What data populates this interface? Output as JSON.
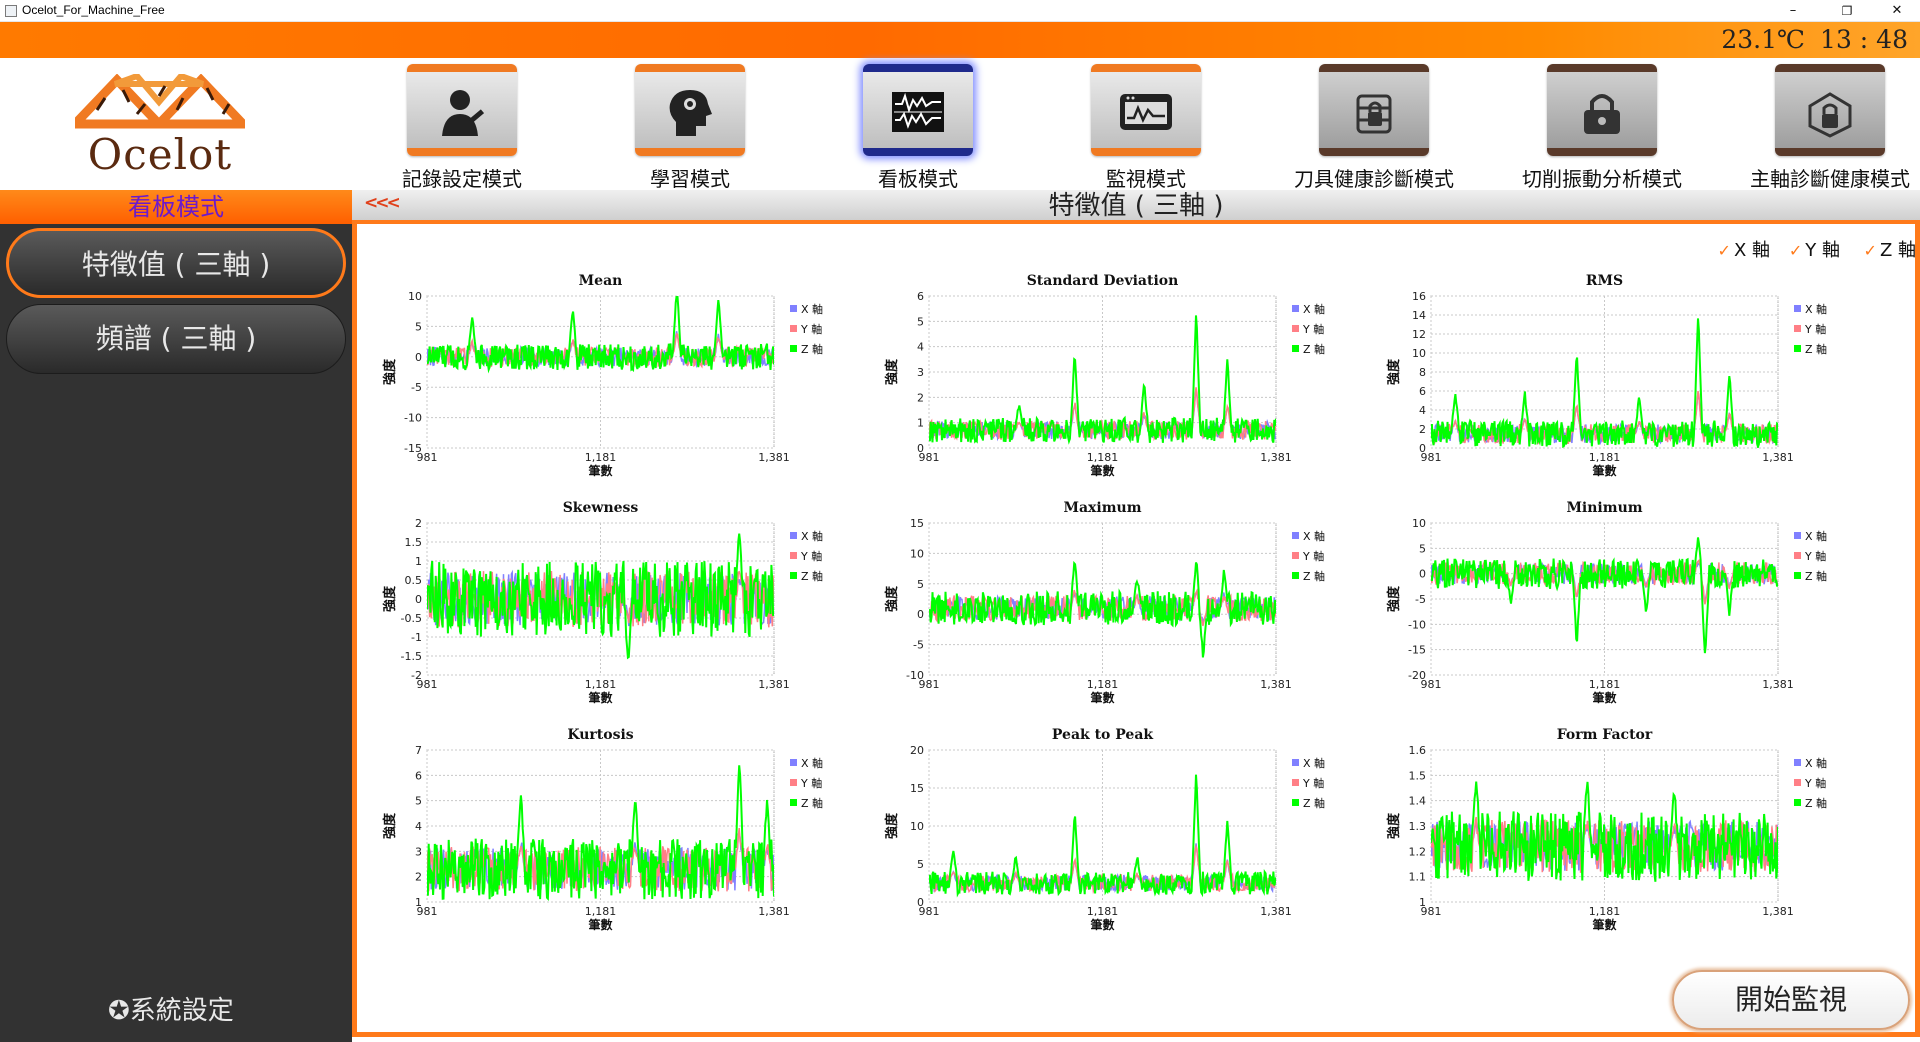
{
  "window": {
    "title": "Ocelot_For_Machine_Free",
    "minimize": "–",
    "restore": "❐",
    "close": "✕"
  },
  "header": {
    "temperature": "23.1℃",
    "clock": "13 : 48"
  },
  "logo": {
    "brand": "Ocelot"
  },
  "modes": [
    {
      "label": "記錄設定模式",
      "icon": "user-wrench-icon",
      "state": "normal"
    },
    {
      "label": "學習模式",
      "icon": "brain-gear-icon",
      "state": "normal"
    },
    {
      "label": "看板模式",
      "icon": "waveform-board-icon",
      "state": "active"
    },
    {
      "label": "監視模式",
      "icon": "monitor-screen-icon",
      "state": "normal"
    },
    {
      "label": "刀具健康診斷模式",
      "icon": "tool-lock-icon",
      "state": "disabled"
    },
    {
      "label": "切削振動分析模式",
      "icon": "padlock-icon",
      "state": "disabled"
    },
    {
      "label": "主軸診斷健康模式",
      "icon": "spindle-lock-icon",
      "state": "disabled"
    }
  ],
  "sidebar": {
    "title": "看板模式",
    "items": [
      {
        "label": "特徵值 ( 三軸 )",
        "active": true
      },
      {
        "label": "頻譜 ( 三軸 )",
        "active": false
      }
    ],
    "settings": "系統設定"
  },
  "content": {
    "back": "<<<",
    "title": "特徵值 ( 三軸 )",
    "axis_toggles": [
      {
        "label": "X 軸",
        "checked": true
      },
      {
        "label": "Y 軸",
        "checked": true
      },
      {
        "label": "Z 軸",
        "checked": true
      }
    ],
    "start_button": "開始監視"
  },
  "colors": {
    "x_axis": "#8080ff",
    "y_axis": "#ff7f86",
    "z_axis": "#00ff00",
    "accent": "#ff7a1a",
    "active_mode": "#1f2a8c"
  },
  "chart_data": [
    {
      "type": "line",
      "title": "Mean",
      "xlabel": "筆數",
      "ylabel": "強度",
      "xlim": [
        981,
        1381
      ],
      "xticks": [
        "981",
        "1,181",
        "1,381"
      ],
      "ylim": [
        -15,
        10
      ],
      "yticks": [
        "-15",
        "-10",
        "-5",
        "0",
        "5",
        "10"
      ],
      "base": 0,
      "amp": 2.2,
      "spikes": [
        [
          0.13,
          7
        ],
        [
          0.42,
          8
        ],
        [
          0.72,
          12
        ],
        [
          0.84,
          10
        ]
      ],
      "series": [
        {
          "name": "X 軸"
        },
        {
          "name": "Y 軸"
        },
        {
          "name": "Z 軸"
        }
      ],
      "legend": "right"
    },
    {
      "type": "line",
      "title": "Standard Deviation",
      "xlabel": "筆數",
      "ylabel": "強度",
      "xlim": [
        981,
        1381
      ],
      "xticks": [
        "981",
        "1,181",
        "1,381"
      ],
      "ylim": [
        0,
        6
      ],
      "yticks": [
        "0",
        "1",
        "2",
        "3",
        "4",
        "5",
        "6"
      ],
      "base": 0.7,
      "amp": 0.5,
      "spikes": [
        [
          0.26,
          1.8
        ],
        [
          0.42,
          3.8
        ],
        [
          0.62,
          2.6
        ],
        [
          0.77,
          5.5
        ],
        [
          0.86,
          3.5
        ]
      ],
      "series": [
        {
          "name": "X 軸"
        },
        {
          "name": "Y 軸"
        },
        {
          "name": "Z 軸"
        }
      ],
      "legend": "right"
    },
    {
      "type": "line",
      "title": "RMS",
      "xlabel": "筆數",
      "ylabel": "強度",
      "xlim": [
        981,
        1381
      ],
      "xticks": [
        "981",
        "1,181",
        "1,381"
      ],
      "ylim": [
        0,
        16
      ],
      "yticks": [
        "0",
        "2",
        "4",
        "6",
        "8",
        "10",
        "12",
        "14",
        "16"
      ],
      "base": 1.5,
      "amp": 1.4,
      "spikes": [
        [
          0.07,
          6
        ],
        [
          0.27,
          6
        ],
        [
          0.42,
          10
        ],
        [
          0.6,
          5.5
        ],
        [
          0.77,
          14.5
        ],
        [
          0.86,
          8
        ]
      ],
      "series": [
        {
          "name": "X 軸"
        },
        {
          "name": "Y 軸"
        },
        {
          "name": "Z 軸"
        }
      ],
      "legend": "right"
    },
    {
      "type": "line",
      "title": "Skewness",
      "xlabel": "筆數",
      "ylabel": "強度",
      "xlim": [
        981,
        1381
      ],
      "xticks": [
        "981",
        "1,181",
        "1,381"
      ],
      "ylim": [
        -2,
        2
      ],
      "yticks": [
        "-2",
        "-1.5",
        "-1",
        "-0.5",
        "0",
        "0.5",
        "1",
        "1.5",
        "2"
      ],
      "base": 0,
      "amp": 1.0,
      "spikes": [
        [
          0.58,
          -1.7
        ],
        [
          0.9,
          1.9
        ]
      ],
      "series": [
        {
          "name": "X 軸"
        },
        {
          "name": "Y 軸"
        },
        {
          "name": "Z 軸"
        }
      ],
      "legend": "right"
    },
    {
      "type": "line",
      "title": "Maximum",
      "xlabel": "筆數",
      "ylabel": "強度",
      "xlim": [
        981,
        1381
      ],
      "xticks": [
        "981",
        "1,181",
        "1,381"
      ],
      "ylim": [
        -10,
        15
      ],
      "yticks": [
        "-10",
        "-5",
        "0",
        "5",
        "10",
        "15"
      ],
      "base": 1,
      "amp": 2.8,
      "spikes": [
        [
          0.42,
          9
        ],
        [
          0.6,
          6
        ],
        [
          0.77,
          9
        ],
        [
          0.79,
          -7
        ],
        [
          0.85,
          7
        ]
      ],
      "series": [
        {
          "name": "X 軸"
        },
        {
          "name": "Y 軸"
        },
        {
          "name": "Z 軸"
        }
      ],
      "legend": "right"
    },
    {
      "type": "line",
      "title": "Minimum",
      "xlabel": "筆數",
      "ylabel": "強度",
      "xlim": [
        981,
        1381
      ],
      "xticks": [
        "981",
        "1,181",
        "1,381"
      ],
      "ylim": [
        -20,
        10
      ],
      "yticks": [
        "-20",
        "-15",
        "-10",
        "-5",
        "0",
        "5",
        "10"
      ],
      "base": 0,
      "amp": 3.0,
      "spikes": [
        [
          0.23,
          -6
        ],
        [
          0.42,
          -14
        ],
        [
          0.62,
          -8
        ],
        [
          0.77,
          7
        ],
        [
          0.79,
          -17
        ],
        [
          0.86,
          -8
        ]
      ],
      "series": [
        {
          "name": "X 軸"
        },
        {
          "name": "Y 軸"
        },
        {
          "name": "Z 軸"
        }
      ],
      "legend": "right"
    },
    {
      "type": "line",
      "title": "Kurtosis",
      "xlabel": "筆數",
      "ylabel": "強度",
      "xlim": [
        981,
        1381
      ],
      "xticks": [
        "981",
        "1,181",
        "1,381"
      ],
      "ylim": [
        1,
        7
      ],
      "yticks": [
        "1",
        "2",
        "3",
        "4",
        "5",
        "6",
        "7"
      ],
      "base": 2.3,
      "amp": 1.2,
      "spikes": [
        [
          0.27,
          5.5
        ],
        [
          0.6,
          5.2
        ],
        [
          0.9,
          6.7
        ],
        [
          0.98,
          5
        ]
      ],
      "series": [
        {
          "name": "X 軸"
        },
        {
          "name": "Y 軸"
        },
        {
          "name": "Z 軸"
        }
      ],
      "legend": "right"
    },
    {
      "type": "line",
      "title": "Peak to Peak",
      "xlabel": "筆數",
      "ylabel": "強度",
      "xlim": [
        981,
        1381
      ],
      "xticks": [
        "981",
        "1,181",
        "1,381"
      ],
      "ylim": [
        0,
        20
      ],
      "yticks": [
        "0",
        "5",
        "10",
        "15",
        "20"
      ],
      "base": 2.5,
      "amp": 1.5,
      "spikes": [
        [
          0.07,
          7
        ],
        [
          0.25,
          6
        ],
        [
          0.42,
          12
        ],
        [
          0.6,
          6
        ],
        [
          0.77,
          17.5
        ],
        [
          0.86,
          11
        ]
      ],
      "series": [
        {
          "name": "X 軸"
        },
        {
          "name": "Y 軸"
        },
        {
          "name": "Z 軸"
        }
      ],
      "legend": "right"
    },
    {
      "type": "line",
      "title": "Form Factor",
      "xlabel": "筆數",
      "ylabel": "強度",
      "xlim": [
        981,
        1381
      ],
      "xticks": [
        "981",
        "1,181",
        "1,381"
      ],
      "ylim": [
        1,
        1.6
      ],
      "yticks": [
        "1",
        "1.1",
        "1.2",
        "1.3",
        "1.4",
        "1.5",
        "1.6"
      ],
      "base": 1.22,
      "amp": 0.14,
      "spikes": [
        [
          0.13,
          1.5
        ],
        [
          0.45,
          1.48
        ],
        [
          0.7,
          1.46
        ]
      ],
      "series": [
        {
          "name": "X 軸"
        },
        {
          "name": "Y 軸"
        },
        {
          "name": "Z 軸"
        }
      ],
      "legend": "right"
    }
  ]
}
